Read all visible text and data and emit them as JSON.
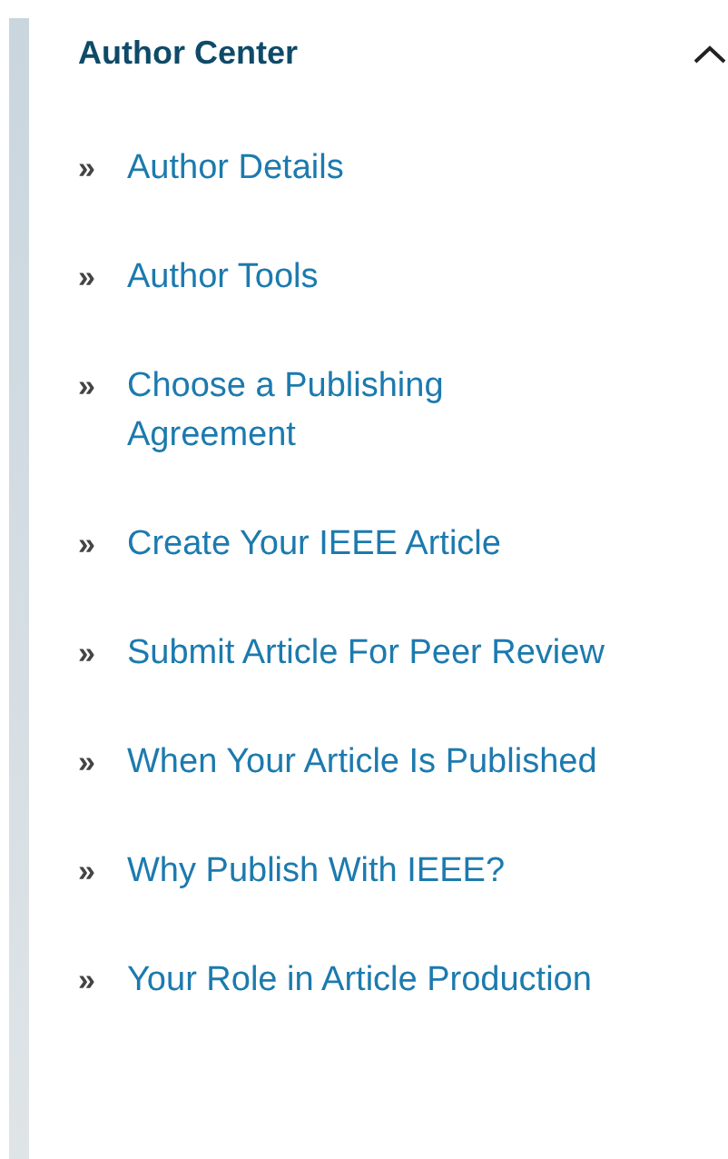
{
  "section": {
    "title": "Author Center",
    "expanded": true,
    "items": [
      {
        "label": "Author Details"
      },
      {
        "label": "Author Tools"
      },
      {
        "label": "Choose a Publishing Agreement"
      },
      {
        "label": "Create Your IEEE Article"
      },
      {
        "label": "Submit Article For Peer Review"
      },
      {
        "label": "When Your Article Is Published"
      },
      {
        "label": "Why Publish With IEEE?"
      },
      {
        "label": "Your Role in Article Production"
      }
    ],
    "bullet": "»"
  }
}
